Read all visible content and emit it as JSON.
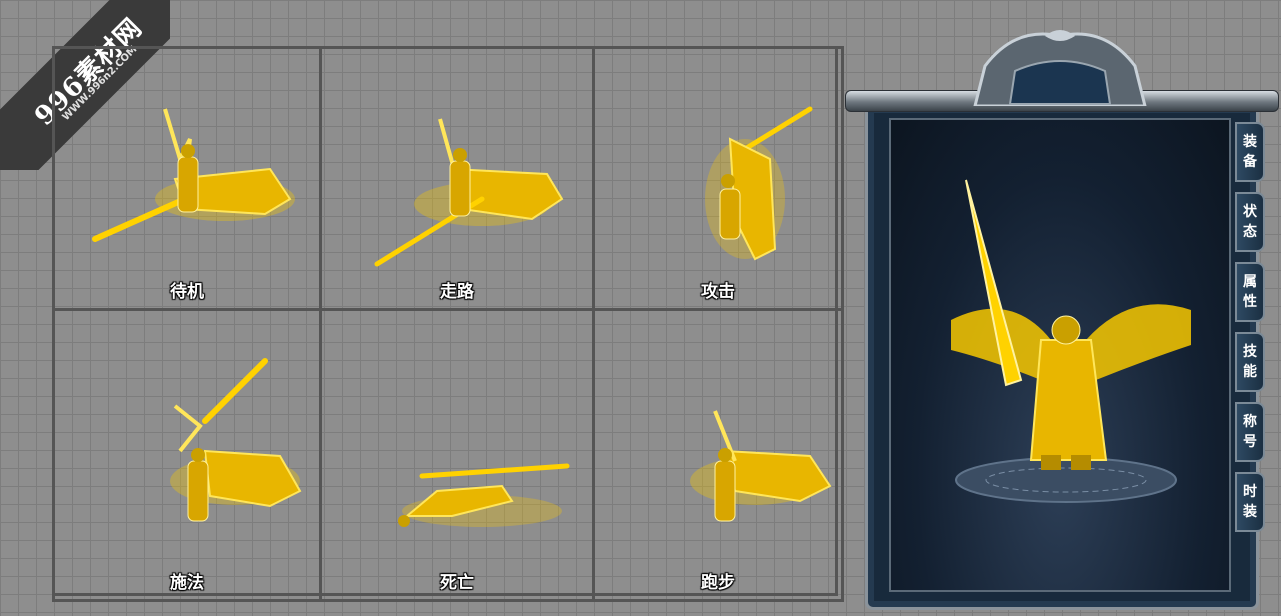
{
  "watermark": {
    "brand": "996素材网",
    "url": "WWW.996n2.COM"
  },
  "actions": [
    {
      "label": "待机"
    },
    {
      "label": "走路"
    },
    {
      "label": "攻击"
    },
    {
      "label": "施法"
    },
    {
      "label": "死亡"
    },
    {
      "label": "跑步"
    }
  ],
  "tabs": [
    {
      "top": "装",
      "bottom": "备"
    },
    {
      "top": "状",
      "bottom": "态"
    },
    {
      "top": "属",
      "bottom": "性"
    },
    {
      "top": "技",
      "bottom": "能"
    },
    {
      "top": "称",
      "bottom": "号"
    },
    {
      "top": "时",
      "bottom": "装"
    }
  ],
  "colors": {
    "gold": "#f7c800",
    "gold_light": "#ffe65a",
    "panel_dark": "#132031",
    "grid_bg": "#8e8e8e"
  }
}
